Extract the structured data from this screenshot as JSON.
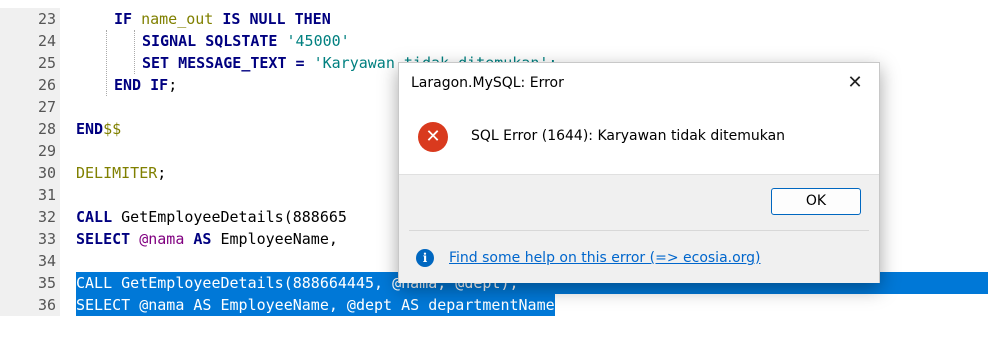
{
  "editor": {
    "lines": [
      {
        "num": "23",
        "tokens": [
          {
            "t": "IF ",
            "c": "kw"
          },
          {
            "t": "name_out ",
            "c": "id"
          },
          {
            "t": "IS NULL THEN",
            "c": "kw"
          }
        ],
        "indent": 38
      },
      {
        "num": "24",
        "tokens": [
          {
            "t": "SIGNAL SQLSTATE ",
            "c": "kw"
          },
          {
            "t": "'45000'",
            "c": "str"
          }
        ],
        "indent": 66
      },
      {
        "num": "25",
        "tokens": [
          {
            "t": "SET MESSAGE_TEXT = ",
            "c": "kw"
          },
          {
            "t": "'Karyawan tidak ditemukan';",
            "c": "str"
          }
        ],
        "indent": 66
      },
      {
        "num": "26",
        "tokens": [
          {
            "t": "END IF",
            "c": "kw"
          },
          {
            "t": ";",
            "c": "plain"
          }
        ],
        "indent": 38
      },
      {
        "num": "27",
        "tokens": [],
        "indent": 0
      },
      {
        "num": "28",
        "tokens": [
          {
            "t": "END",
            "c": "kw"
          },
          {
            "t": "$$",
            "c": "id"
          }
        ],
        "indent": 0
      },
      {
        "num": "29",
        "tokens": [],
        "indent": 0
      },
      {
        "num": "30",
        "tokens": [
          {
            "t": "DELIMITER",
            "c": "id"
          },
          {
            "t": ";",
            "c": "plain"
          }
        ],
        "indent": 0
      },
      {
        "num": "31",
        "tokens": [],
        "indent": 0
      },
      {
        "num": "32",
        "tokens": [
          {
            "t": "CALL ",
            "c": "kw"
          },
          {
            "t": "GetEmployeeDetails(888665",
            "c": "plain"
          }
        ],
        "indent": 0
      },
      {
        "num": "33",
        "tokens": [
          {
            "t": "SELECT ",
            "c": "kw"
          },
          {
            "t": "@nama ",
            "c": "var"
          },
          {
            "t": "AS ",
            "c": "kw"
          },
          {
            "t": "EmployeeName,",
            "c": "plain"
          }
        ],
        "indent": 0
      },
      {
        "num": "34",
        "tokens": [],
        "indent": 0
      },
      {
        "num": "35",
        "tokens": [
          {
            "t": "CALL GetEmployeeDetails(888664445, @nama, @dept);",
            "c": "plain"
          }
        ],
        "indent": 0,
        "selected": true
      },
      {
        "num": "36",
        "tokens": [
          {
            "t": "SELECT @nama AS EmployeeName, @dept AS departmentName",
            "c": "plain"
          }
        ],
        "indent": 0,
        "selected": true
      }
    ]
  },
  "dialog": {
    "title": "Laragon.MySQL: Error",
    "close_glyph": "✕",
    "error_glyph": "✕",
    "message": "SQL Error (1644): Karyawan tidak ditemukan",
    "ok_label": "OK",
    "info_glyph": "i",
    "help_link": "Find some help on this error (=> ecosia.org)"
  },
  "colors": {
    "selection": "#0078d7",
    "keyword": "#000080",
    "identifier": "#808000",
    "string": "#008080",
    "error": "#d93a1e",
    "link": "#0066cc"
  }
}
